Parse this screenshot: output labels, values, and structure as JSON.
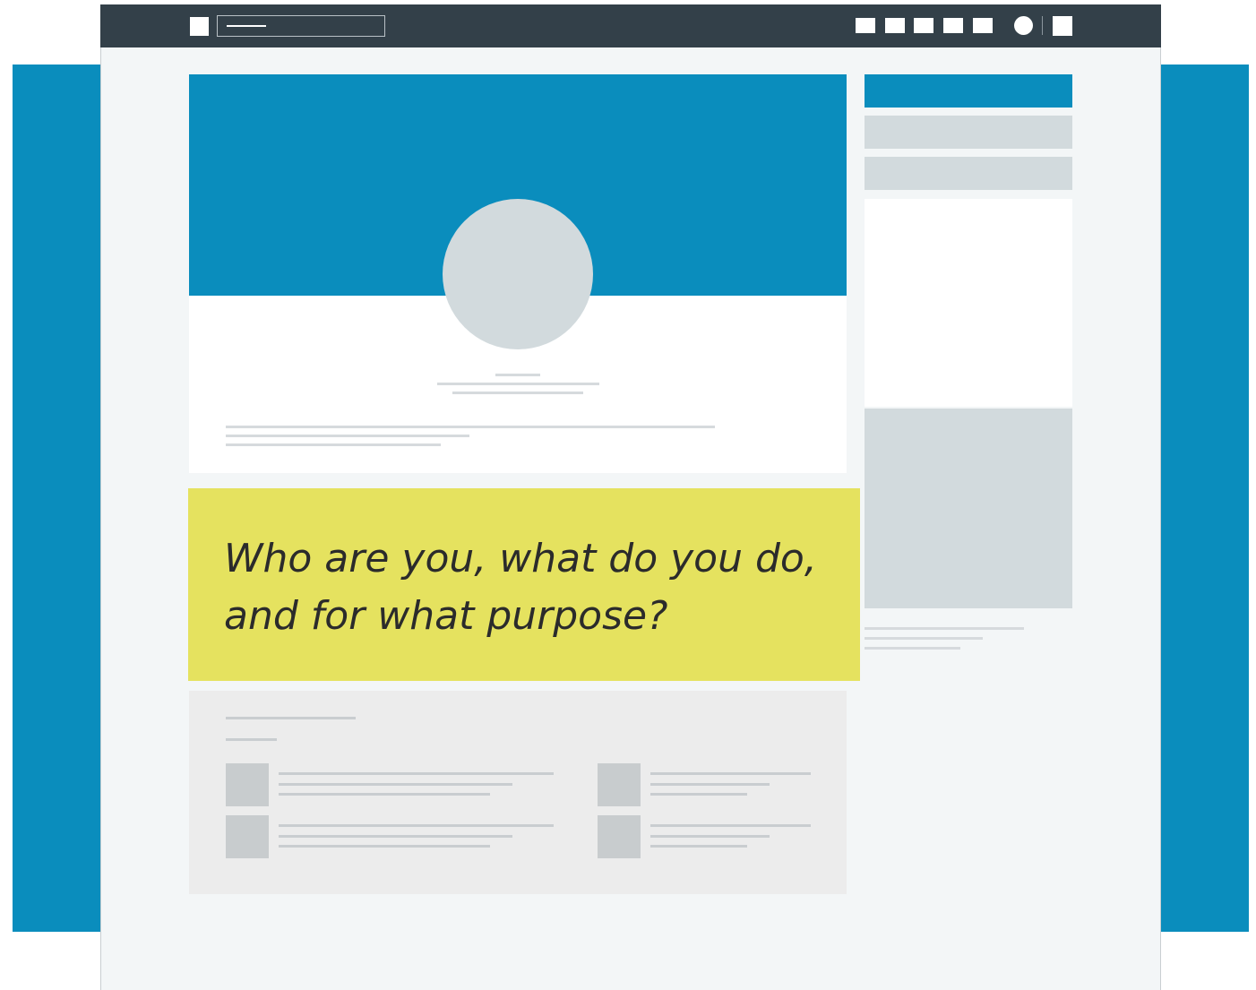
{
  "colors": {
    "brand_blue": "#0a8dbd",
    "topbar": "#334049",
    "callout_yellow": "#e5e25f",
    "placeholder_gray": "#d2dadd",
    "page_background": "#f3f6f7"
  },
  "header": {
    "logo_icon": "logo-square-icon",
    "nav_icons": [
      "nav-item-icon",
      "nav-item-icon",
      "nav-item-icon",
      "nav-item-icon",
      "nav-item-icon"
    ],
    "profile_icon": "profile-circle-icon",
    "menu_icon": "menu-square-icon"
  },
  "callout": {
    "line1": "Who are you, what do you do,",
    "line2": "and for what purpose?"
  }
}
